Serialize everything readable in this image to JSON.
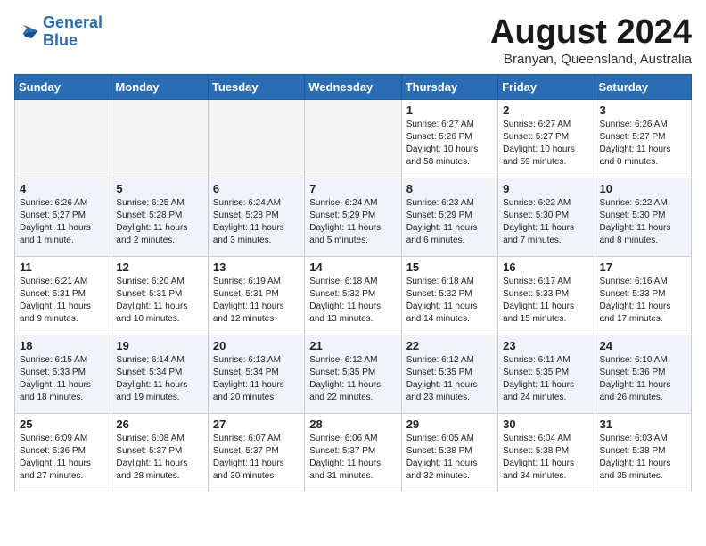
{
  "header": {
    "logo_line1": "General",
    "logo_line2": "Blue",
    "month": "August 2024",
    "location": "Branyan, Queensland, Australia"
  },
  "weekdays": [
    "Sunday",
    "Monday",
    "Tuesday",
    "Wednesday",
    "Thursday",
    "Friday",
    "Saturday"
  ],
  "weeks": [
    [
      {
        "day": "",
        "info": ""
      },
      {
        "day": "",
        "info": ""
      },
      {
        "day": "",
        "info": ""
      },
      {
        "day": "",
        "info": ""
      },
      {
        "day": "1",
        "info": "Sunrise: 6:27 AM\nSunset: 5:26 PM\nDaylight: 10 hours\nand 58 minutes."
      },
      {
        "day": "2",
        "info": "Sunrise: 6:27 AM\nSunset: 5:27 PM\nDaylight: 10 hours\nand 59 minutes."
      },
      {
        "day": "3",
        "info": "Sunrise: 6:26 AM\nSunset: 5:27 PM\nDaylight: 11 hours\nand 0 minutes."
      }
    ],
    [
      {
        "day": "4",
        "info": "Sunrise: 6:26 AM\nSunset: 5:27 PM\nDaylight: 11 hours\nand 1 minute."
      },
      {
        "day": "5",
        "info": "Sunrise: 6:25 AM\nSunset: 5:28 PM\nDaylight: 11 hours\nand 2 minutes."
      },
      {
        "day": "6",
        "info": "Sunrise: 6:24 AM\nSunset: 5:28 PM\nDaylight: 11 hours\nand 3 minutes."
      },
      {
        "day": "7",
        "info": "Sunrise: 6:24 AM\nSunset: 5:29 PM\nDaylight: 11 hours\nand 5 minutes."
      },
      {
        "day": "8",
        "info": "Sunrise: 6:23 AM\nSunset: 5:29 PM\nDaylight: 11 hours\nand 6 minutes."
      },
      {
        "day": "9",
        "info": "Sunrise: 6:22 AM\nSunset: 5:30 PM\nDaylight: 11 hours\nand 7 minutes."
      },
      {
        "day": "10",
        "info": "Sunrise: 6:22 AM\nSunset: 5:30 PM\nDaylight: 11 hours\nand 8 minutes."
      }
    ],
    [
      {
        "day": "11",
        "info": "Sunrise: 6:21 AM\nSunset: 5:31 PM\nDaylight: 11 hours\nand 9 minutes."
      },
      {
        "day": "12",
        "info": "Sunrise: 6:20 AM\nSunset: 5:31 PM\nDaylight: 11 hours\nand 10 minutes."
      },
      {
        "day": "13",
        "info": "Sunrise: 6:19 AM\nSunset: 5:31 PM\nDaylight: 11 hours\nand 12 minutes."
      },
      {
        "day": "14",
        "info": "Sunrise: 6:18 AM\nSunset: 5:32 PM\nDaylight: 11 hours\nand 13 minutes."
      },
      {
        "day": "15",
        "info": "Sunrise: 6:18 AM\nSunset: 5:32 PM\nDaylight: 11 hours\nand 14 minutes."
      },
      {
        "day": "16",
        "info": "Sunrise: 6:17 AM\nSunset: 5:33 PM\nDaylight: 11 hours\nand 15 minutes."
      },
      {
        "day": "17",
        "info": "Sunrise: 6:16 AM\nSunset: 5:33 PM\nDaylight: 11 hours\nand 17 minutes."
      }
    ],
    [
      {
        "day": "18",
        "info": "Sunrise: 6:15 AM\nSunset: 5:33 PM\nDaylight: 11 hours\nand 18 minutes."
      },
      {
        "day": "19",
        "info": "Sunrise: 6:14 AM\nSunset: 5:34 PM\nDaylight: 11 hours\nand 19 minutes."
      },
      {
        "day": "20",
        "info": "Sunrise: 6:13 AM\nSunset: 5:34 PM\nDaylight: 11 hours\nand 20 minutes."
      },
      {
        "day": "21",
        "info": "Sunrise: 6:12 AM\nSunset: 5:35 PM\nDaylight: 11 hours\nand 22 minutes."
      },
      {
        "day": "22",
        "info": "Sunrise: 6:12 AM\nSunset: 5:35 PM\nDaylight: 11 hours\nand 23 minutes."
      },
      {
        "day": "23",
        "info": "Sunrise: 6:11 AM\nSunset: 5:35 PM\nDaylight: 11 hours\nand 24 minutes."
      },
      {
        "day": "24",
        "info": "Sunrise: 6:10 AM\nSunset: 5:36 PM\nDaylight: 11 hours\nand 26 minutes."
      }
    ],
    [
      {
        "day": "25",
        "info": "Sunrise: 6:09 AM\nSunset: 5:36 PM\nDaylight: 11 hours\nand 27 minutes."
      },
      {
        "day": "26",
        "info": "Sunrise: 6:08 AM\nSunset: 5:37 PM\nDaylight: 11 hours\nand 28 minutes."
      },
      {
        "day": "27",
        "info": "Sunrise: 6:07 AM\nSunset: 5:37 PM\nDaylight: 11 hours\nand 30 minutes."
      },
      {
        "day": "28",
        "info": "Sunrise: 6:06 AM\nSunset: 5:37 PM\nDaylight: 11 hours\nand 31 minutes."
      },
      {
        "day": "29",
        "info": "Sunrise: 6:05 AM\nSunset: 5:38 PM\nDaylight: 11 hours\nand 32 minutes."
      },
      {
        "day": "30",
        "info": "Sunrise: 6:04 AM\nSunset: 5:38 PM\nDaylight: 11 hours\nand 34 minutes."
      },
      {
        "day": "31",
        "info": "Sunrise: 6:03 AM\nSunset: 5:38 PM\nDaylight: 11 hours\nand 35 minutes."
      }
    ]
  ]
}
